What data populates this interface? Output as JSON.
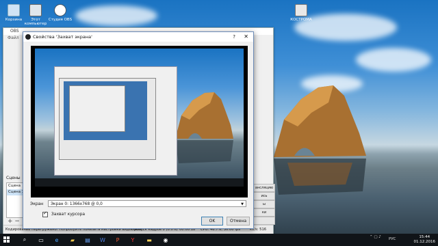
{
  "desktop": {
    "icons": [
      {
        "label": "Корзина",
        "icon": "recycle-bin-icon"
      },
      {
        "label": "Этот компьютер",
        "icon": "computer-icon"
      },
      {
        "label": "Студия OBS",
        "icon": "obs-icon"
      },
      {
        "label": "КОСТРОМА",
        "icon": "file-icon"
      }
    ]
  },
  "obs": {
    "title": "OBS",
    "menu": "Файл",
    "scenes_label": "Сцены",
    "scenes": [
      "Сцена",
      "Сцена 1"
    ],
    "status_left": "Кодирование перегружено! Попробуйте понизить настройки видео или...",
    "status_dropped": "Пропуск кадров 0 (0.0%)",
    "status_time": "00:00:18",
    "status_cpu": "CPU: 46.7%, 30.00 fps",
    "status_kbs": "kb/s: 516",
    "right_buttons": [
      "ансляцию",
      "ись",
      "ы",
      "ки",
      ""
    ]
  },
  "dialog": {
    "title": "Свойства 'Захват экрана'",
    "help": "?",
    "close": "✕",
    "screen_label": "Экран",
    "screen_value": "Экран 0: 1366x768 @ 0,0",
    "capture_cursor": "Захват курсора",
    "ok_label": "OK",
    "cancel_label": "Отмена"
  },
  "taskbar": {
    "tray_lang": "РУС",
    "time": "15:44",
    "date": "01.12.2016"
  },
  "colors": {
    "taskbar": "#101418",
    "dialog_border": "#6b8bb7",
    "ok_border": "#3c7fb1"
  }
}
